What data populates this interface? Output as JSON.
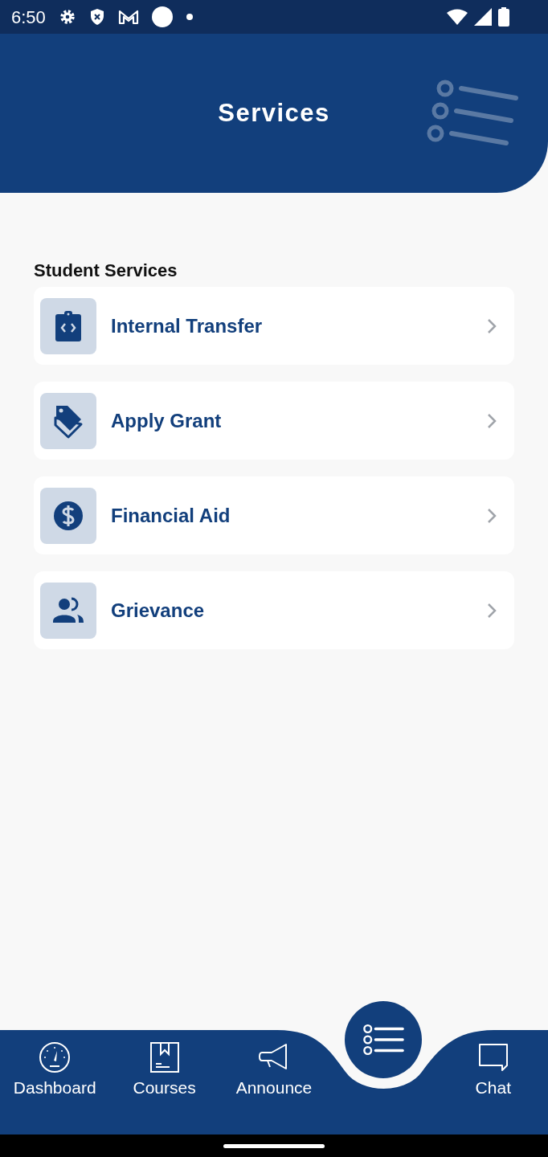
{
  "status_bar": {
    "time": "6:50"
  },
  "header": {
    "title": "Services"
  },
  "section": {
    "title": "Student Services"
  },
  "services": [
    {
      "label": "Internal Transfer"
    },
    {
      "label": "Apply Grant"
    },
    {
      "label": "Financial Aid"
    },
    {
      "label": "Grievance"
    }
  ],
  "bottom_nav": {
    "items": [
      {
        "label": "Dashboard"
      },
      {
        "label": "Courses"
      },
      {
        "label": "Announce"
      },
      {
        "label": "Chat"
      }
    ]
  }
}
